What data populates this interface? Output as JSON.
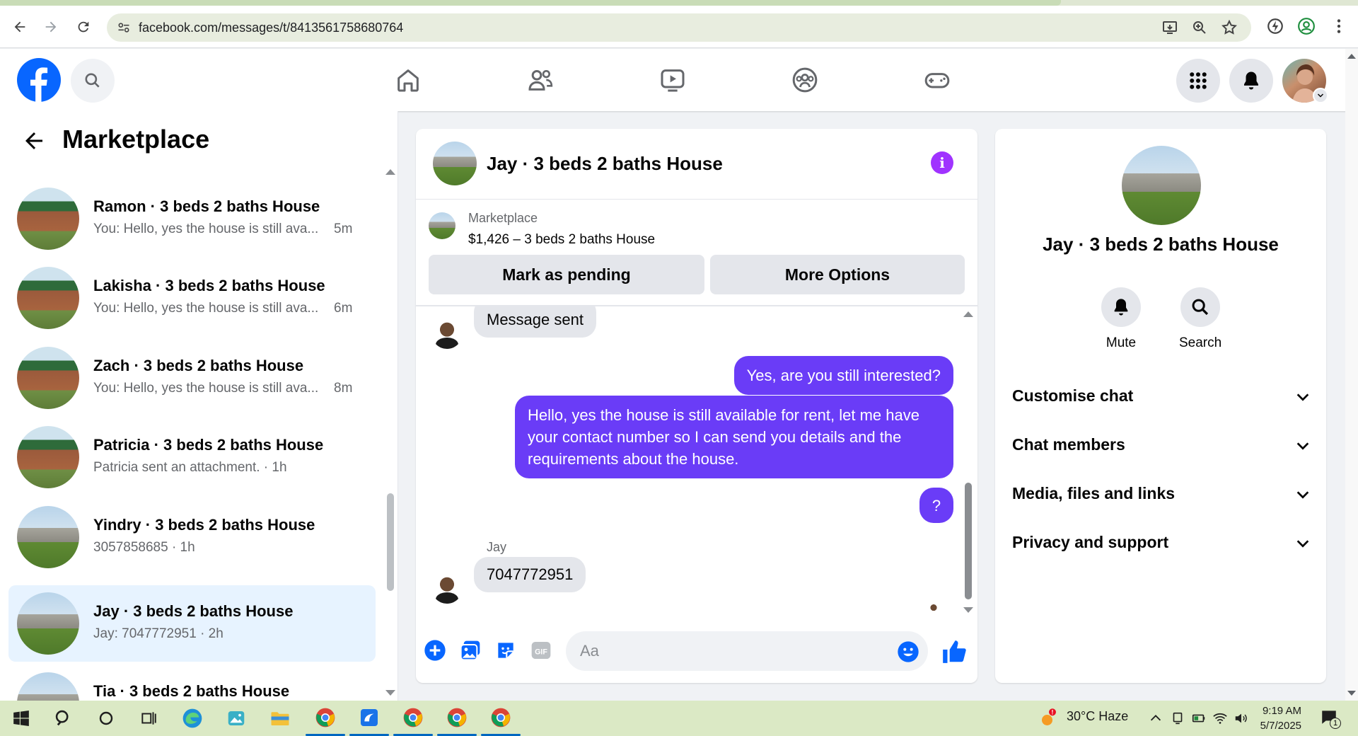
{
  "browser": {
    "url": "facebook.com/messages/t/8413561758680764"
  },
  "left_panel": {
    "title": "Marketplace",
    "conversations": [
      {
        "name": "Ramon · 3 beds 2 baths House",
        "preview": "You: Hello, yes the house is still ava...",
        "time": "5m",
        "avatar": "brick-house"
      },
      {
        "name": "Lakisha · 3 beds 2 baths House",
        "preview": "You: Hello, yes the house is still ava...",
        "time": "6m",
        "avatar": "brick-house"
      },
      {
        "name": "Zach · 3 beds 2 baths House",
        "preview": "You: Hello, yes the house is still ava...",
        "time": "8m",
        "avatar": "brick-house"
      },
      {
        "name": "Patricia · 3 beds 2 baths House",
        "preview": "Patricia sent an attachment. · 1h",
        "time": "",
        "avatar": "brick-house"
      },
      {
        "name": "Yindry · 3 beds 2 baths House",
        "preview": "3057858685 · 1h",
        "time": "",
        "avatar": "gray-house"
      },
      {
        "name": "Jay · 3 beds 2 baths House",
        "preview": "Jay: 7047772951 · 2h",
        "time": "",
        "avatar": "gray-house",
        "active": true
      },
      {
        "name": "Tia · 3 beds 2 baths House",
        "preview": "",
        "time": "",
        "avatar": "gray-house"
      }
    ]
  },
  "chat": {
    "title": "Jay · 3 beds 2 baths House",
    "marketplace_label": "Marketplace",
    "listing": "$1,426 – 3 beds 2 baths House",
    "mark_pending_label": "Mark as pending",
    "more_options_label": "More Options",
    "messages": {
      "message_sent": "Message sent",
      "out_1": "Yes, are you still interested?",
      "out_2": "Hello, yes the house is still available for rent, let me have your contact number so I can send you details and the requirements about the house.",
      "out_3": "?",
      "sender_name": "Jay",
      "in_1": "7047772951"
    },
    "composer_placeholder": "Aa"
  },
  "right_panel": {
    "name": "Jay · 3 beds 2 baths House",
    "mute_label": "Mute",
    "search_label": "Search",
    "sections": [
      "Customise chat",
      "Chat members",
      "Media, files and links",
      "Privacy and support"
    ]
  },
  "taskbar": {
    "weather": "30°C  Haze",
    "time": "9:19 AM",
    "date": "5/7/2025",
    "notification_count": "1"
  },
  "colors": {
    "fb_blue": "#0866ff",
    "outgoing_bubble": "#6a3cf7",
    "info_purple": "#a033ff",
    "active_conversation": "#e7f3ff"
  }
}
